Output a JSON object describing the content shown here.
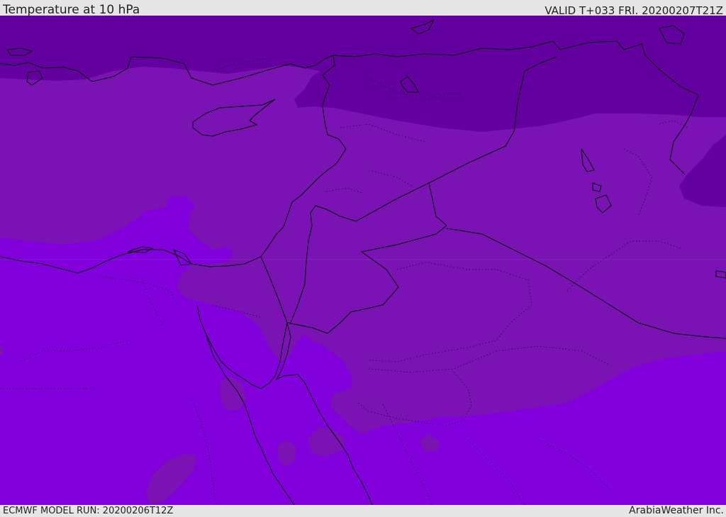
{
  "header": {
    "title": "Temperature at 10 hPa",
    "valid_time": "VALID T+033 FRI. 20200207T21Z"
  },
  "footer": {
    "model_run": "ECMWF MODEL RUN: 20200206T12Z",
    "credit": "ArabiaWeather Inc."
  },
  "map": {
    "field": "temperature",
    "level": "10 hPa",
    "colors": {
      "coldest": "#6400a0",
      "mid": "#7a12b4",
      "warm": "#8200dc",
      "coastline": "#000000",
      "border": "#000000"
    }
  }
}
